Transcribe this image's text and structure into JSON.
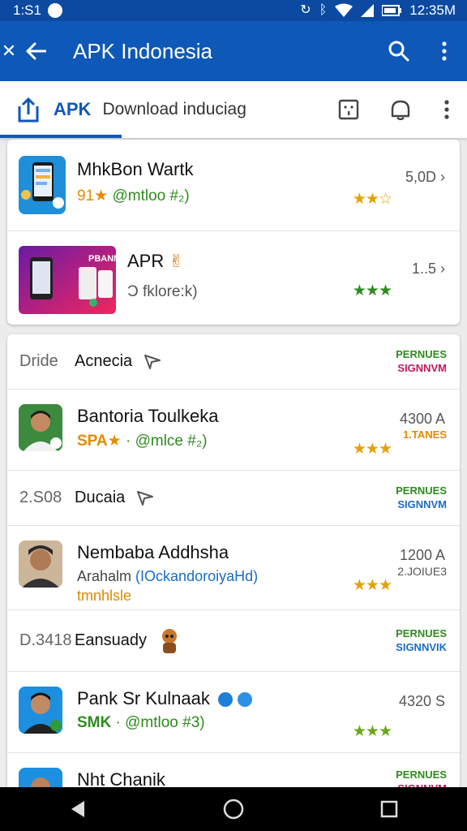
{
  "status_bar": {
    "time_left": "1:S1",
    "time_right": "12:35M",
    "icons": [
      "notification-dot-icon",
      "sync-icon",
      "bluetooth-icon",
      "wifi-icon",
      "signal-icon",
      "battery-icon"
    ]
  },
  "app_bar": {
    "title": "APK Indonesia",
    "icons": [
      "close-edge-icon",
      "back-arrow-icon",
      "search-icon",
      "more-vert-icon"
    ]
  },
  "tab_bar": {
    "apk_label": "APK",
    "download_label": "Download induciag",
    "icons": [
      "share-upload-icon",
      "scan-icon",
      "notification-bell-icon",
      "more-vert-icon"
    ]
  },
  "featured": [
    {
      "title": "MhkBon Wartk",
      "sub_prefix": "91★",
      "sub_rest": "@mtloo #₂)",
      "right_value": "5,0D ›",
      "stars": "★★☆",
      "thumb": "phone-app-icon"
    },
    {
      "title": "APR",
      "emoji": "✌",
      "sub": "Ɔ fklore:k)",
      "right_value": "1..5 ›",
      "stars": "★★★",
      "thumb": "promo-banner-image",
      "thumb_text": "PBANN"
    }
  ],
  "list": [
    {
      "kind": "section",
      "label": "Dride",
      "title": "Acnecia",
      "badge_top": "PERNUES",
      "badge_bottom": "SIGNNVM"
    },
    {
      "kind": "person",
      "title": "Bantoria Toulkeka",
      "sub_prefix": "SPA★",
      "sub_rest": "· @mlce #₂)",
      "right_value": "4300 A",
      "right_tag": "1.TANES",
      "stars": "★★★"
    },
    {
      "kind": "section",
      "label": "2.S08",
      "title": "Ducaia",
      "badge_top": "PERNUES",
      "badge_bottom": "SIGNNVM"
    },
    {
      "kind": "person",
      "title": "Nembaba Addhsha",
      "sub_prefix": "Arahalm",
      "sub_rest": "(IOckandoroiyaHd)",
      "sub2": "tmnhlsle",
      "right_value": "1200 A",
      "right_tag": "2.JOIUE3",
      "stars": "★★★"
    },
    {
      "kind": "section",
      "label": "D.3418",
      "title": "Eansuady",
      "badge_top": "PERNUES",
      "badge_bottom": "SIGNNVIK"
    },
    {
      "kind": "person",
      "title": "Pank Sr Kulnaak",
      "sub_prefix": "SMK",
      "sub_rest": "· @mtloo #3)",
      "right_value": "4320 S",
      "stars": "★★★"
    },
    {
      "kind": "person-partial",
      "title": "Nht Chanik",
      "badge_top": "PERNUES",
      "badge_bottom": "SIGNNVM"
    }
  ],
  "colors": {
    "primary": "#0e58b8",
    "status": "#0b4aa0",
    "star_gold": "#e6a100",
    "star_green": "#2e8b1e",
    "badge_green": "#2e8b1e",
    "badge_red": "#c2185b",
    "badge_blue": "#1a6cc4"
  },
  "nav_bar": {
    "icons": [
      "nav-back-icon",
      "nav-home-icon",
      "nav-recents-icon"
    ]
  }
}
